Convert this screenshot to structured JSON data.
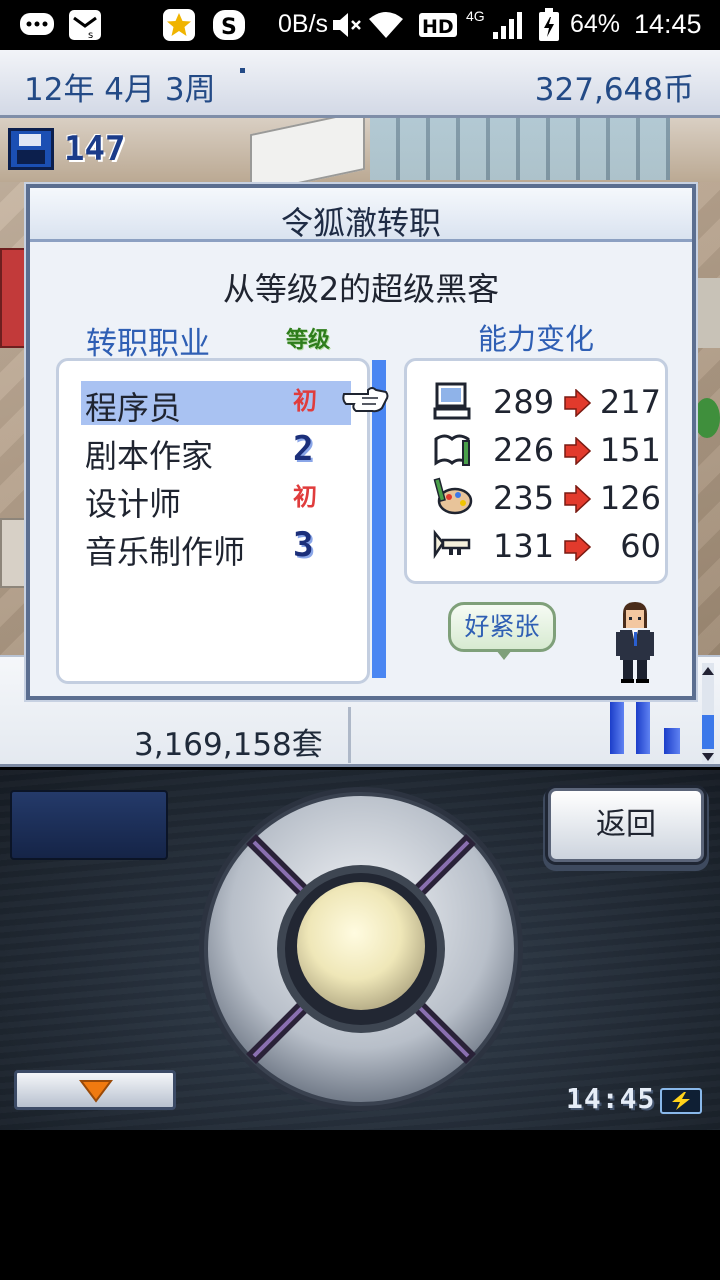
{
  "status_bar": {
    "network_speed": "0B/s",
    "battery_percent": "64%",
    "time": "14:45",
    "hd_label": "HD",
    "network_type": "4G",
    "icons": [
      "chat-icon",
      "mail-icon",
      "star-app-icon",
      "sogou-icon",
      "mute-icon",
      "wifi-icon",
      "signal-icon",
      "battery-icon"
    ]
  },
  "top_bar": {
    "date": "12年 4月 3周",
    "money": "327,648币"
  },
  "save_count": "147",
  "dialog": {
    "title": "令狐澈转职",
    "subtitle": "从等级2的超级黑客",
    "job_column_label": "转职职业",
    "level_column_label": "等级",
    "ability_column_label": "能力变化",
    "jobs": [
      {
        "name": "程序员",
        "level": "初",
        "selected": true
      },
      {
        "name": "剧本作家",
        "level": "2",
        "selected": false
      },
      {
        "name": "设计师",
        "level": "初",
        "selected": false
      },
      {
        "name": "音乐制作师",
        "level": "3",
        "selected": false
      }
    ],
    "abilities": [
      {
        "icon": "computer-icon",
        "before": "289",
        "after": "217"
      },
      {
        "icon": "book-pen-icon",
        "before": "226",
        "after": "151"
      },
      {
        "icon": "palette-icon",
        "before": "235",
        "after": "126"
      },
      {
        "icon": "trumpet-icon",
        "before": "131",
        "after": "60"
      }
    ],
    "speech_bubble": "好紧张"
  },
  "info_strip": {
    "sales": "3,169,158套"
  },
  "controller": {
    "back_label": "返回",
    "clock": "14:45"
  },
  "colors": {
    "accent_blue": "#2f5fb4",
    "selected_row": "#a9c2f2",
    "arrow_red": "#e23a2c",
    "level_new": "#e03c3c"
  }
}
